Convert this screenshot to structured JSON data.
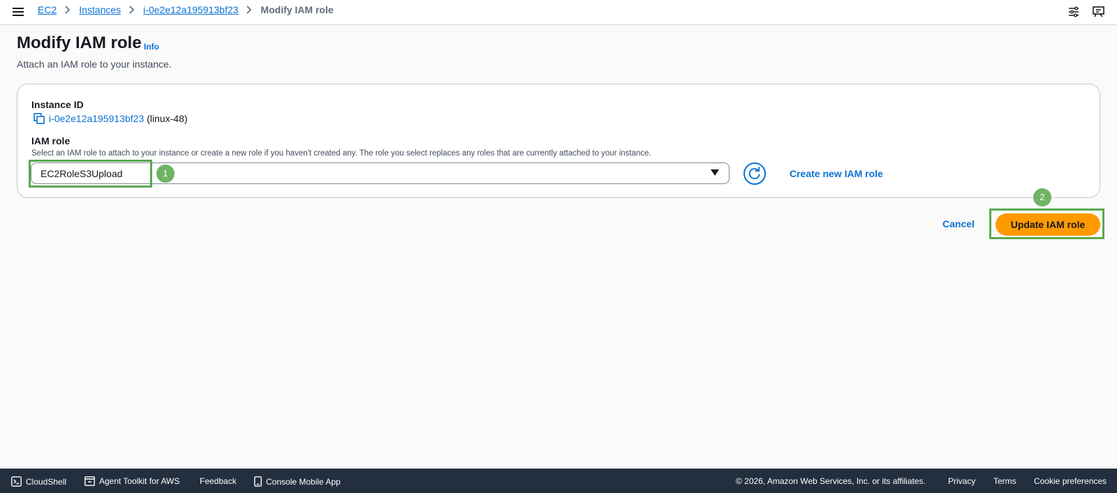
{
  "breadcrumb": {
    "items": [
      "EC2",
      "Instances",
      "i-0e2e12a195913bf23"
    ],
    "current": "Modify IAM role"
  },
  "header": {
    "title": "Modify IAM role",
    "info_label": "Info",
    "description": "Attach an IAM role to your instance."
  },
  "form": {
    "instance_label": "Instance ID",
    "instance_id": "i-0e2e12a195913bf23",
    "instance_name": "(linux-48)",
    "role_label": "IAM role",
    "role_hint": "Select an IAM role to attach to your instance or create a new role if you haven't created any. The role you select replaces any roles that are currently attached to your instance.",
    "role_value": "EC2RoleS3Upload",
    "create_link": "Create new IAM role"
  },
  "actions": {
    "cancel_label": "Cancel",
    "submit_label": "Update IAM role"
  },
  "markers": [
    "1",
    "2"
  ],
  "footer": {
    "cloudshell": "CloudShell",
    "agent_toolkit": "Agent Toolkit for AWS",
    "feedback": "Feedback",
    "mobile_app": "Console Mobile App",
    "copyright": "© 2026, Amazon Web Services, Inc. or its affiliates.",
    "privacy": "Privacy",
    "terms": "Terms",
    "cookies": "Cookie preferences"
  },
  "colors": {
    "link": "#0972d3",
    "primary": "#ff9900",
    "highlight": "#5aa94f",
    "footer_bg": "#232f3e"
  },
  "icons": [
    "menu-icon",
    "chevron-right-icon",
    "settings-sliders-icon",
    "notification-icon",
    "copy-icon",
    "caret-down-icon",
    "refresh-icon",
    "terminal-icon",
    "toolkit-icon",
    "phone-icon"
  ]
}
